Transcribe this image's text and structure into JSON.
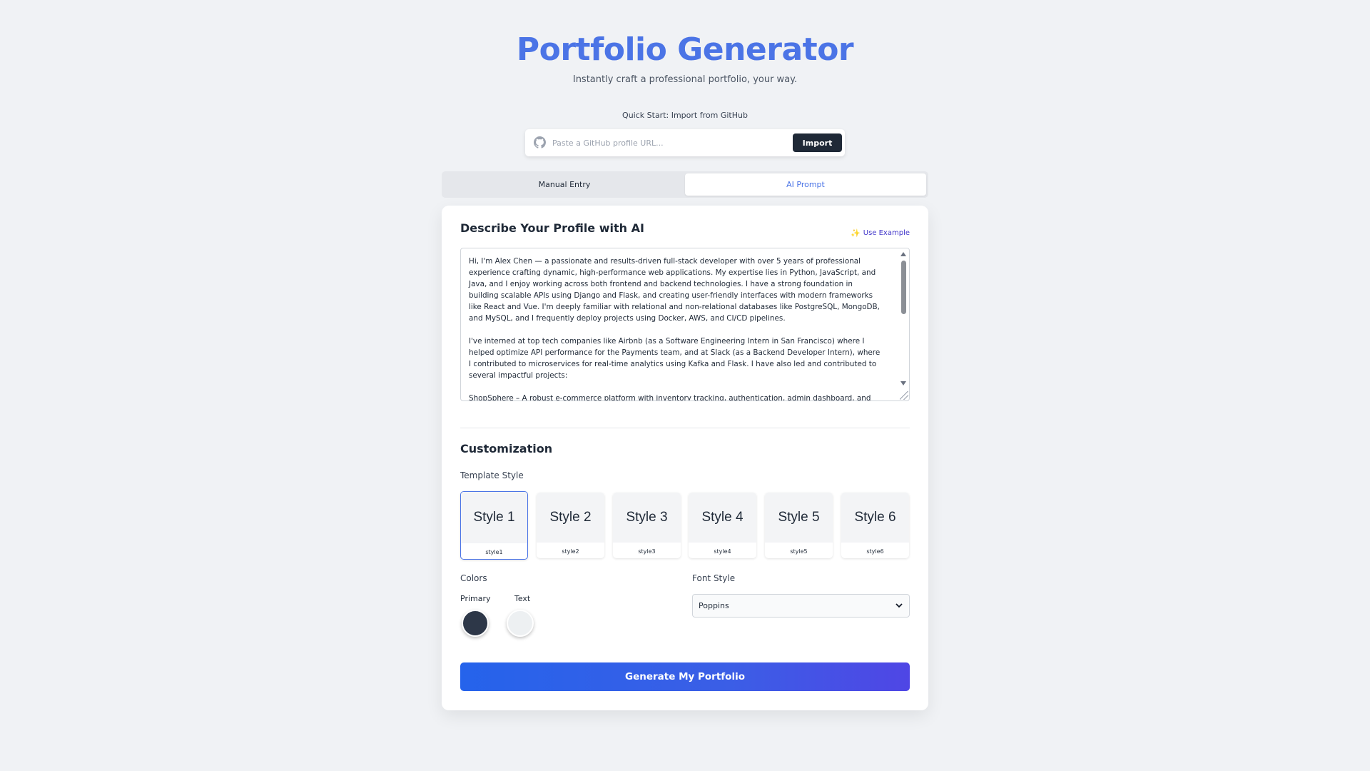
{
  "header": {
    "title": "Portfolio Generator",
    "subtitle": "Instantly craft a professional portfolio, your way."
  },
  "github_import": {
    "label": "Quick Start: Import from GitHub",
    "placeholder": "Paste a GitHub profile URL...",
    "value": "",
    "button_label": "Import",
    "icon": "github-icon"
  },
  "tabs": [
    {
      "label": "Manual Entry",
      "active": false
    },
    {
      "label": "AI Prompt",
      "active": true
    }
  ],
  "ai_section": {
    "title": "Describe Your Profile with AI",
    "use_example_label": "Use Example",
    "use_example_icon": "sparkle-icon",
    "prompt_text": "Hi, I'm Alex Chen — a passionate and results-driven full-stack developer with over 5 years of professional\nexperience crafting dynamic, high-performance web applications. My expertise lies in Python, JavaScript, and\nJava, and I enjoy working across both frontend and backend technologies. I have a strong foundation in\nbuilding scalable APIs using Django and Flask, and creating user-friendly interfaces with modern frameworks\nlike React and Vue. I'm deeply familiar with relational and non-relational databases like PostgreSQL, MongoDB,\nand MySQL, and I frequently deploy projects using Docker, AWS, and CI/CD pipelines.\n\nI've interned at top tech companies like Airbnb (as a Software Engineering Intern in San Francisco) where I\nhelped optimize API performance for the Payments team, and at Slack (as a Backend Developer Intern), where\nI contributed to microservices for real-time analytics using Kafka and Flask. I have also led and contributed to\nseveral impactful projects:\n\nShopSphere – A robust e-commerce platform with inventory tracking, authentication, admin dashboard, and"
  },
  "customization": {
    "title": "Customization",
    "template_label": "Template Style",
    "templates": [
      {
        "preview": "Style 1",
        "name": "style1",
        "selected": true
      },
      {
        "preview": "Style 2",
        "name": "style2",
        "selected": false
      },
      {
        "preview": "Style 3",
        "name": "style3",
        "selected": false
      },
      {
        "preview": "Style 4",
        "name": "style4",
        "selected": false
      },
      {
        "preview": "Style 5",
        "name": "style5",
        "selected": false
      },
      {
        "preview": "Style 6",
        "name": "style6",
        "selected": false
      }
    ],
    "colors_label": "Colors",
    "primary_label": "Primary",
    "primary_color": "#2d3748",
    "text_label": "Text",
    "text_color": "#edf0f2",
    "font_label": "Font Style",
    "font_value": "Poppins"
  },
  "generate_button_label": "Generate My Portfolio",
  "theme": {
    "accent": "#4b74e6",
    "background": "#f0f2f5",
    "button_gradient": [
      "#2563eb",
      "#4f46e5"
    ]
  }
}
